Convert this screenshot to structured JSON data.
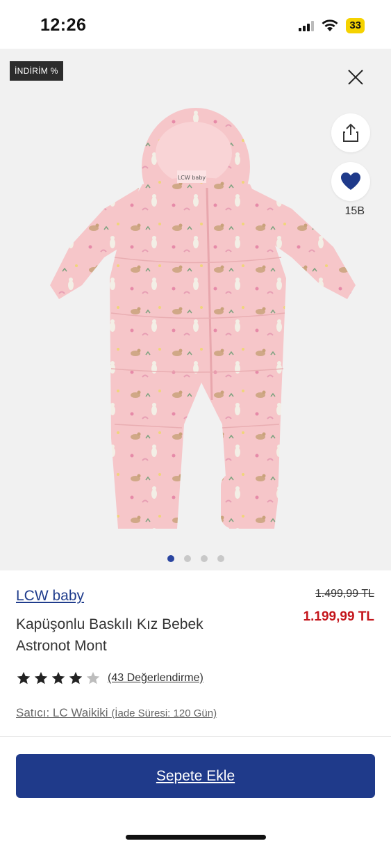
{
  "status": {
    "time": "12:26",
    "battery": "33"
  },
  "product_image": {
    "discount_badge": "İNDİRİM %",
    "favorite_count": "15B",
    "slides_total": 4,
    "active_slide": 1,
    "accent_color": "#1f3a8a"
  },
  "product": {
    "brand": "LCW baby",
    "title": "Kapüşonlu Baskılı Kız Bebek Astronot Mont",
    "old_price": "1.499,99 TL",
    "new_price": "1.199,99 TL",
    "rating_value": 4,
    "rating_max": 5,
    "review_text": "(43 Değerlendirme)",
    "seller_label": "Satıcı: LC Waikiki",
    "return_info": "(İade Süresi: 120 Gün)",
    "price_color": "#c4161c"
  },
  "cta": {
    "add_to_cart": "Sepete Ekle"
  }
}
